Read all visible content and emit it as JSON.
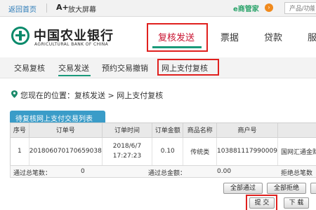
{
  "topbar": {
    "home": "返回首页",
    "aplus": "A+",
    "zoom": "放大屏幕",
    "manager": "e商管家",
    "manager_badge": "›",
    "search_placeholder": "产品/功能"
  },
  "logo": {
    "cn": "中国农业银行",
    "en": "AGRICULTURAL BANK OF CHINA"
  },
  "mainnav": [
    "复核发送",
    "票据",
    "贷款",
    "服"
  ],
  "subnav": [
    "交易复核",
    "交易发送",
    "预约交易撤销",
    "网上支付复核"
  ],
  "breadcrumb": "您现在的位置：复核发送 > 网上支付复核",
  "table": {
    "title": "待复核网上支付交易列表",
    "headers": [
      "序号",
      "订单号",
      "订单时间",
      "订单金额",
      "商品名称",
      "商户号",
      ""
    ],
    "rows": [
      {
        "seq": "1",
        "order_no": "201806070170659038",
        "time_date": "2018/6/7",
        "time_clock": "17:27:23",
        "amount": "0.10",
        "product": "传统类",
        "merchant_no": "103881117990009",
        "extra": "国网汇通金财"
      }
    ]
  },
  "summary": {
    "pass_count_label": "通过总笔数：",
    "pass_count": "0",
    "pass_amount_label": "通过总金额：",
    "pass_amount": "0.00",
    "reject_count_label": "拒绝总笔数"
  },
  "buttons": {
    "pass_all": "全部通过",
    "reject_all": "全部拒绝",
    "submit": "提 交",
    "download": "下 载"
  },
  "colors": {
    "brand_green": "#0a8a6b",
    "highlight_red": "#e0201e",
    "tab_blue": "#3a9cc8"
  }
}
